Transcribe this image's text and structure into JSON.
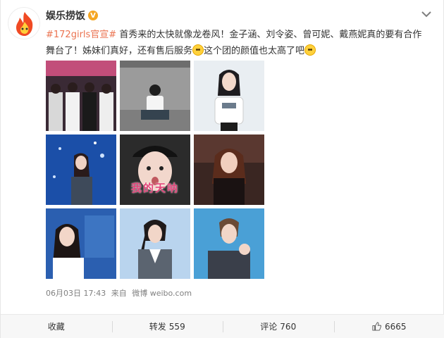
{
  "post": {
    "author": "娱乐捞饭",
    "verified_badge": "V",
    "topic": "#172girls官宣#",
    "text_1": " 首秀来的太快就像龙卷风！金子涵、刘令姿、曾可妮、戴燕妮真的要有合作舞台了！姊妹们真好，还有售后服务",
    "text_2": "这个团的颜值也太高了吧",
    "image_caption": "我的天呐",
    "timestamp": "06月03日 17:43",
    "source_prefix": "来自",
    "source": "微博 weibo.com"
  },
  "actions": {
    "favorite_label": "收藏",
    "repost_label": "转发",
    "repost_count": "559",
    "comment_label": "评论",
    "comment_count": "760",
    "like_count": "6665"
  },
  "icons": {
    "menu": "chevron-down-icon",
    "like": "thumbs-up-icon",
    "emoji1": "crying-emoji-icon",
    "emoji2": "laughing-emoji-icon"
  },
  "colors": {
    "topic": "#eb7350",
    "accent": "#ff8200"
  }
}
